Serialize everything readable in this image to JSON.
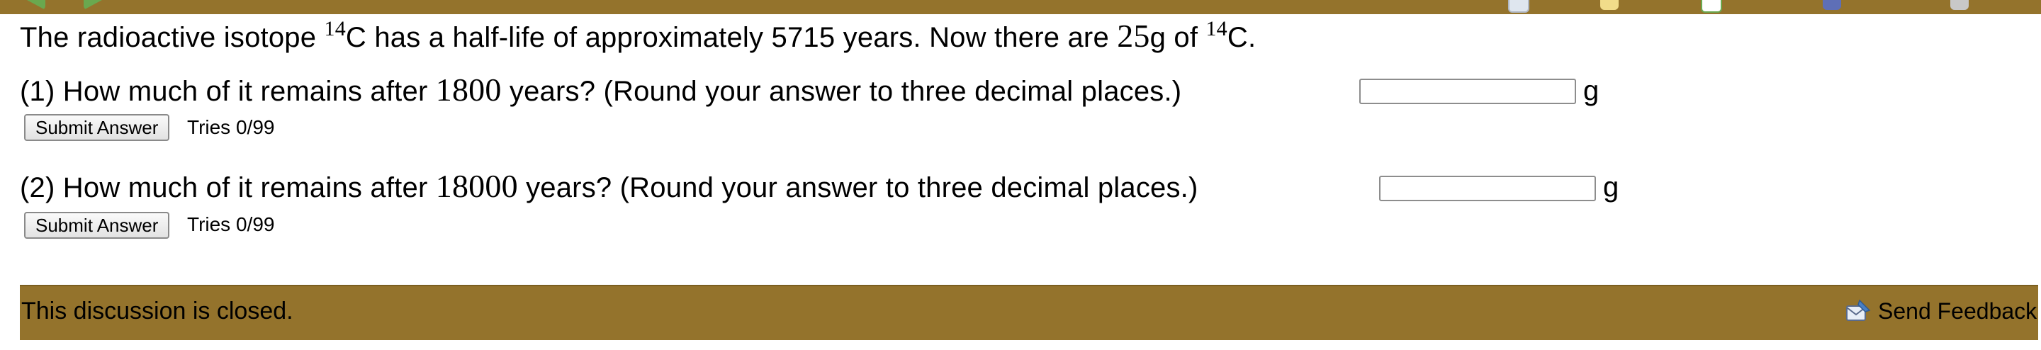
{
  "toolbar": {
    "icons": [
      "back-arrow-icon",
      "forward-arrow-icon",
      "clock-icon",
      "note-icon",
      "grades-icon",
      "puzzle-icon",
      "print-icon"
    ]
  },
  "problem": {
    "intro": {
      "part1": "The radioactive isotope ",
      "iso_mass": "14",
      "iso_sym": "C",
      "part2": " has a half-life of approximately 5715 years. Now there are ",
      "amount": "25",
      "unit_g": "g",
      "part3": " of ",
      "iso_mass2": "14",
      "iso_sym2": "C",
      "end": "."
    },
    "questions": [
      {
        "prefix": "(1) How much of it remains after ",
        "years": "1800",
        "suffix": " years? (Round your answer to three decimal places.)",
        "value": "",
        "unit": "g",
        "submit_label": "Submit Answer",
        "tries": "Tries 0/99"
      },
      {
        "prefix": "(2) How much of it remains after ",
        "years": "18000",
        "suffix": " years? (Round your answer to three decimal places.)",
        "value": "",
        "unit": "g",
        "submit_label": "Submit Answer",
        "tries": "Tries 0/99"
      }
    ]
  },
  "footer": {
    "closed_text": "This discussion is closed.",
    "feedback_label": "Send Feedback"
  },
  "colors": {
    "bar": "#94732c",
    "nav_arrow": "#6aa84f"
  }
}
